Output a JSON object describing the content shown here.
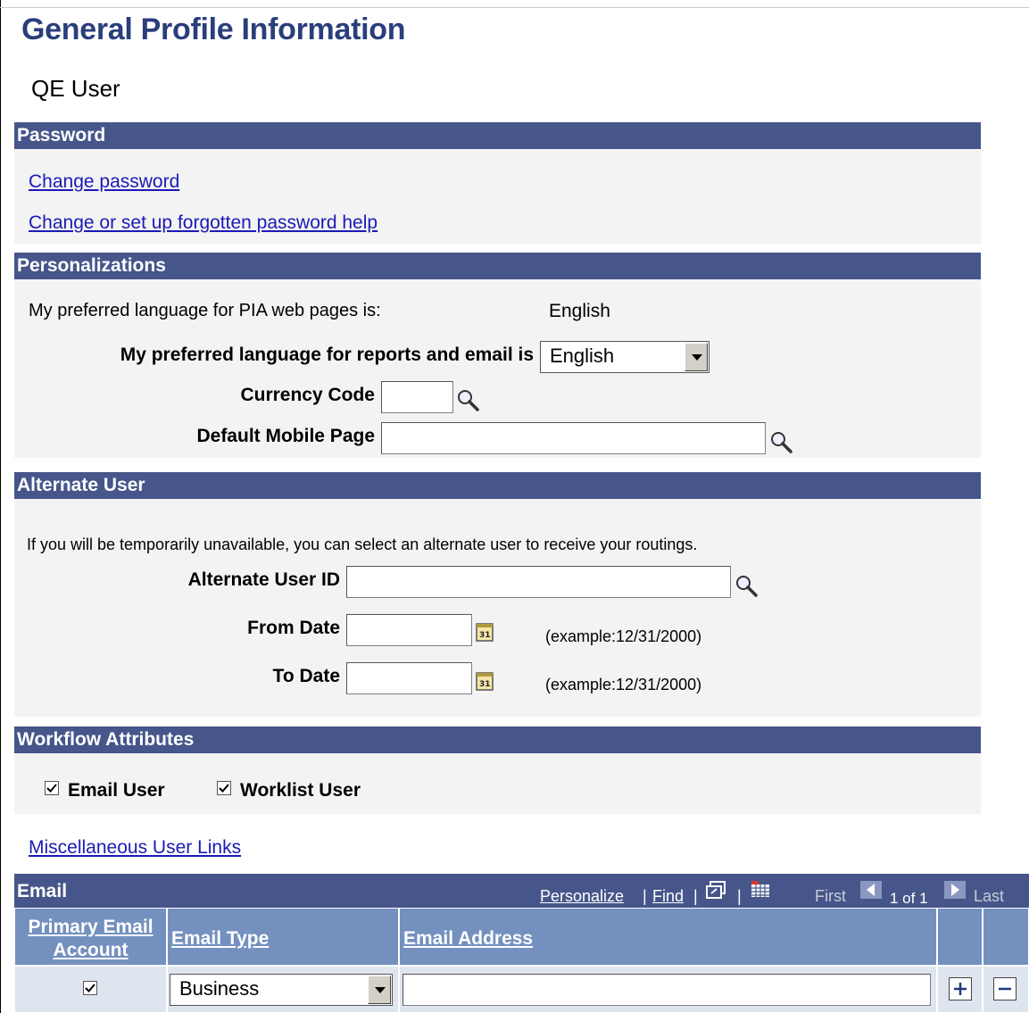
{
  "page": {
    "title": "General Profile Information",
    "user_name": "QE User"
  },
  "password": {
    "header": "Password",
    "change_password": "Change password",
    "forgotten_help": "Change or set up forgotten password help"
  },
  "personalizations": {
    "header": "Personalizations",
    "pia_language_label": "My preferred language for PIA web pages is:",
    "pia_language_value": "English",
    "reports_language_label": "My preferred language for reports and email is",
    "reports_language_value": "English",
    "currency_code_label": "Currency Code",
    "currency_code_value": "",
    "mobile_page_label": "Default Mobile Page",
    "mobile_page_value": ""
  },
  "alternate_user": {
    "header": "Alternate User",
    "description": "If you will be temporarily unavailable, you can select an alternate user to receive your routings.",
    "user_id_label": "Alternate User ID",
    "user_id_value": "",
    "from_date_label": "From Date",
    "from_date_value": "",
    "from_date_hint": "(example:12/31/2000)",
    "to_date_label": "To Date",
    "to_date_value": "",
    "to_date_hint": "(example:12/31/2000)"
  },
  "workflow": {
    "header": "Workflow Attributes",
    "email_user_label": "Email User",
    "email_user_checked": true,
    "worklist_user_label": "Worklist User",
    "worklist_user_checked": true
  },
  "misc_link": "Miscellaneous User Links",
  "email_grid": {
    "title": "Email",
    "personalize": "Personalize",
    "find": "Find",
    "sep": "|",
    "first": "First",
    "page_info": "1 of 1",
    "last": "Last",
    "columns": [
      "Primary Email Account",
      "Email Type",
      "Email Address"
    ],
    "rows": [
      {
        "primary": true,
        "type": "Business",
        "address": ""
      }
    ]
  },
  "colors": {
    "section_header": "#46568a",
    "grid_column_header": "#7490bf",
    "link": "#1a1ab8",
    "title": "#2a3e7b"
  }
}
